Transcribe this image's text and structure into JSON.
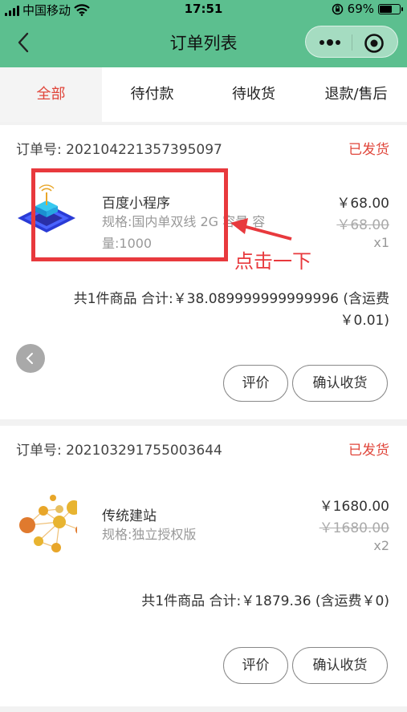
{
  "status_bar": {
    "carrier": "中国移动",
    "time": "17:51",
    "battery_percent": "69%",
    "battery_level": 0.69
  },
  "nav": {
    "title": "订单列表"
  },
  "tabs": [
    {
      "label": "全部",
      "active": true
    },
    {
      "label": "待付款",
      "active": false
    },
    {
      "label": "待收货",
      "active": false
    },
    {
      "label": "退款/售后",
      "active": false
    }
  ],
  "orders": [
    {
      "order_no_label": "订单号:",
      "order_no": "202104221357395097",
      "status": "已发货",
      "product_name": "百度小程序",
      "spec": "规格:国内单双线 2G 容量 容量:1000",
      "price": "￥68.00",
      "old_price": "￥68.00",
      "qty": "x1",
      "summary_line1": "共1件商品   合计:￥38.089999999999996 (含运费",
      "summary_line2": "￥0.01)",
      "btn_review": "评价",
      "btn_confirm": "确认收货"
    },
    {
      "order_no_label": "订单号:",
      "order_no": "202103291755003644",
      "status": "已发货",
      "product_name": "传统建站",
      "spec": "规格:独立授权版",
      "price": "￥1680.00",
      "old_price": "￥1680.00",
      "qty": "x2",
      "summary_line1": "共1件商品   合计:￥1879.36 (含运费￥0)",
      "btn_review": "评价",
      "btn_confirm": "确认收货"
    }
  ],
  "annotation": {
    "text": "点击一下"
  },
  "colors": {
    "brand_green": "#5cbf8f",
    "status_red": "#e0453a",
    "annotation_red": "#e8393d"
  }
}
